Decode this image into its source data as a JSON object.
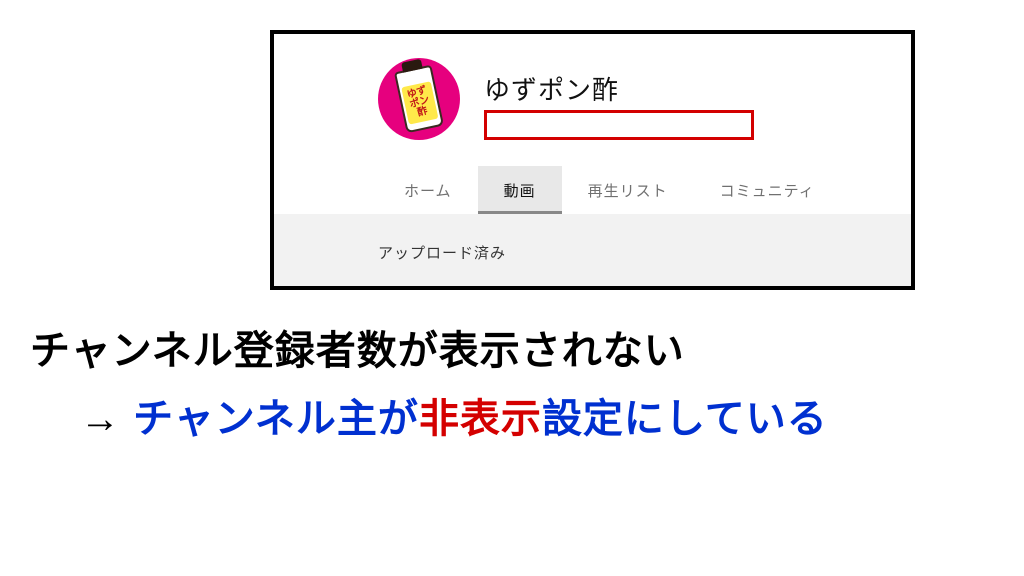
{
  "avatar": {
    "bottle_label": "ゆず\nポン酢"
  },
  "channel": {
    "name": "ゆずポン酢"
  },
  "tabs": {
    "home": "ホーム",
    "videos": "動画",
    "playlists": "再生リスト",
    "community": "コミュニティ"
  },
  "upload_status": "アップロード済み",
  "caption": {
    "line1": "チャンネル登録者数が表示されない",
    "arrow": "→",
    "l2_a": "チャンネル主が",
    "l2_b": "非表示",
    "l2_c": "設定にしている"
  }
}
